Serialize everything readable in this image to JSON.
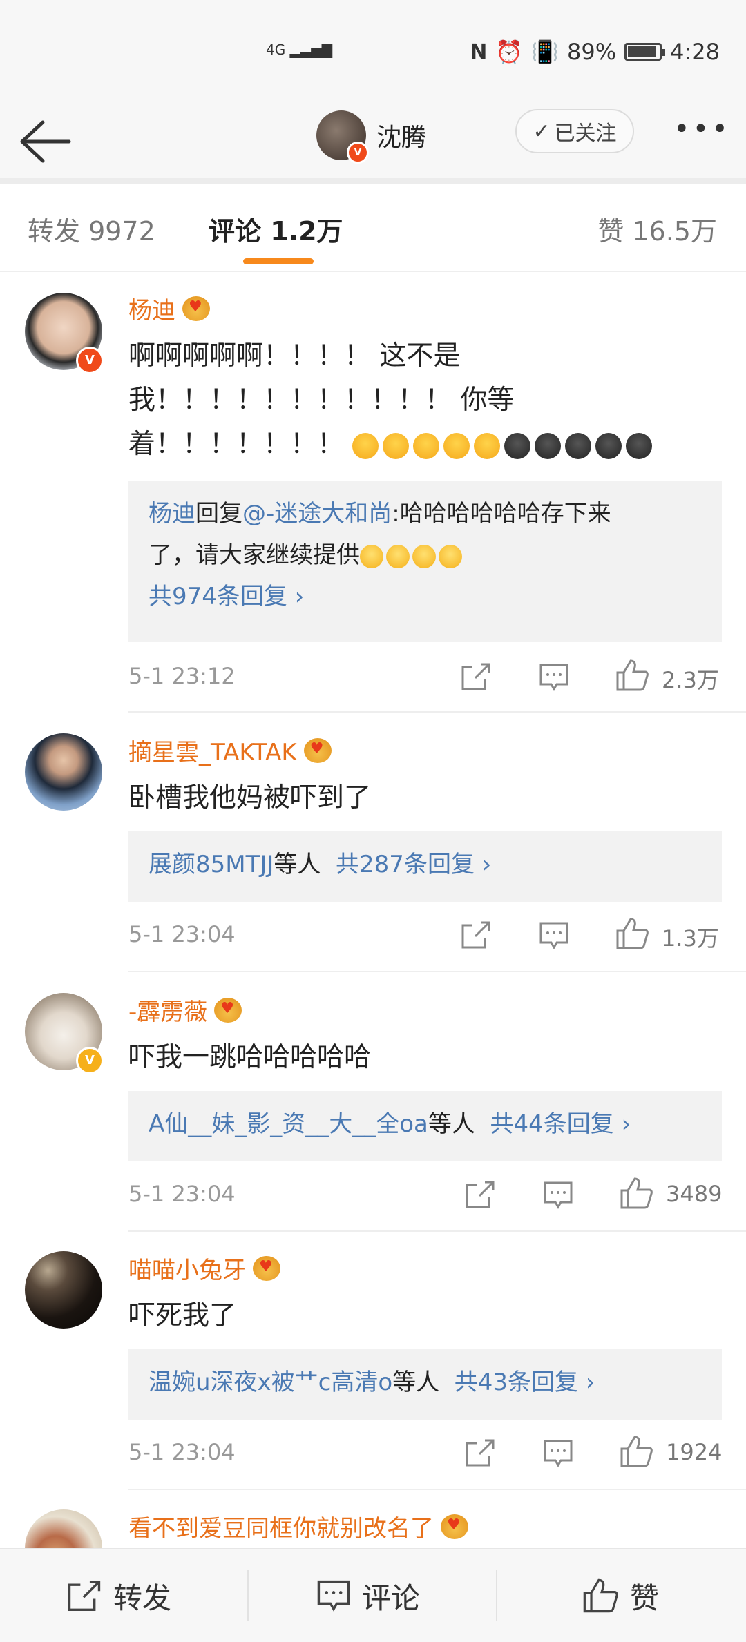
{
  "status_bar": {
    "network": "4G",
    "battery": "89%",
    "battery_level": 0.89,
    "time": "4:28"
  },
  "nav": {
    "user_name": "沈腾",
    "follow_label": "已关注"
  },
  "tabs": {
    "repost": "转发 9972",
    "comment": "评论 1.2万",
    "like": "赞 16.5万"
  },
  "comments": [
    {
      "name": "杨迪",
      "text_lines": [
        "啊啊啊啊啊！！！！ 这不是",
        "我！！！！！！！！！！！ 你等",
        "着！！！！！！！ "
      ],
      "reply": {
        "author": "杨迪",
        "reply_word": "回复",
        "target": "@-迷途大和尚",
        "text_1": ":哈哈哈哈哈哈存下来",
        "text_2": "了，请大家继续提供",
        "more": "共974条回复 ›"
      },
      "time": "5-1 23:12",
      "likes": "2.3万"
    },
    {
      "name": "摘星雲_TAKTAK",
      "text": "卧槽我他妈被吓到了",
      "reply_users": "展颜85MTJJ",
      "reply_suffix": "等人",
      "reply_more": "共287条回复 ›",
      "time": "5-1 23:04",
      "likes": "1.3万"
    },
    {
      "name": "-霹雳薇",
      "text": "吓我一跳哈哈哈哈哈",
      "reply_users": "A仙__妹_影_资__大__全oa",
      "reply_suffix": "等人",
      "reply_more": "共44条回复 ›",
      "time": "5-1 23:04",
      "likes": "3489"
    },
    {
      "name": "喵喵小兔牙",
      "text": "吓死我了",
      "reply_users": "温婉u深夜x被艹c高清o",
      "reply_suffix": "等人",
      "reply_more": "共43条回复 ›",
      "time": "5-1 23:04",
      "likes": "1924"
    },
    {
      "name": "看不到爱豆同框你就别改名了"
    }
  ],
  "bottom_bar": {
    "repost": "转发",
    "comment": "评论",
    "like": "赞"
  },
  "colors": {
    "accent": "#f7891c",
    "name": "#e8701a",
    "link": "#4a79b3",
    "verified_red": "#f04a1a",
    "verified_yellow": "#f6b01b"
  },
  "icons": [
    "back-arrow-icon",
    "more-icon",
    "repost-icon",
    "comment-icon",
    "like-icon",
    "chevron-right-icon",
    "crown-icon"
  ]
}
